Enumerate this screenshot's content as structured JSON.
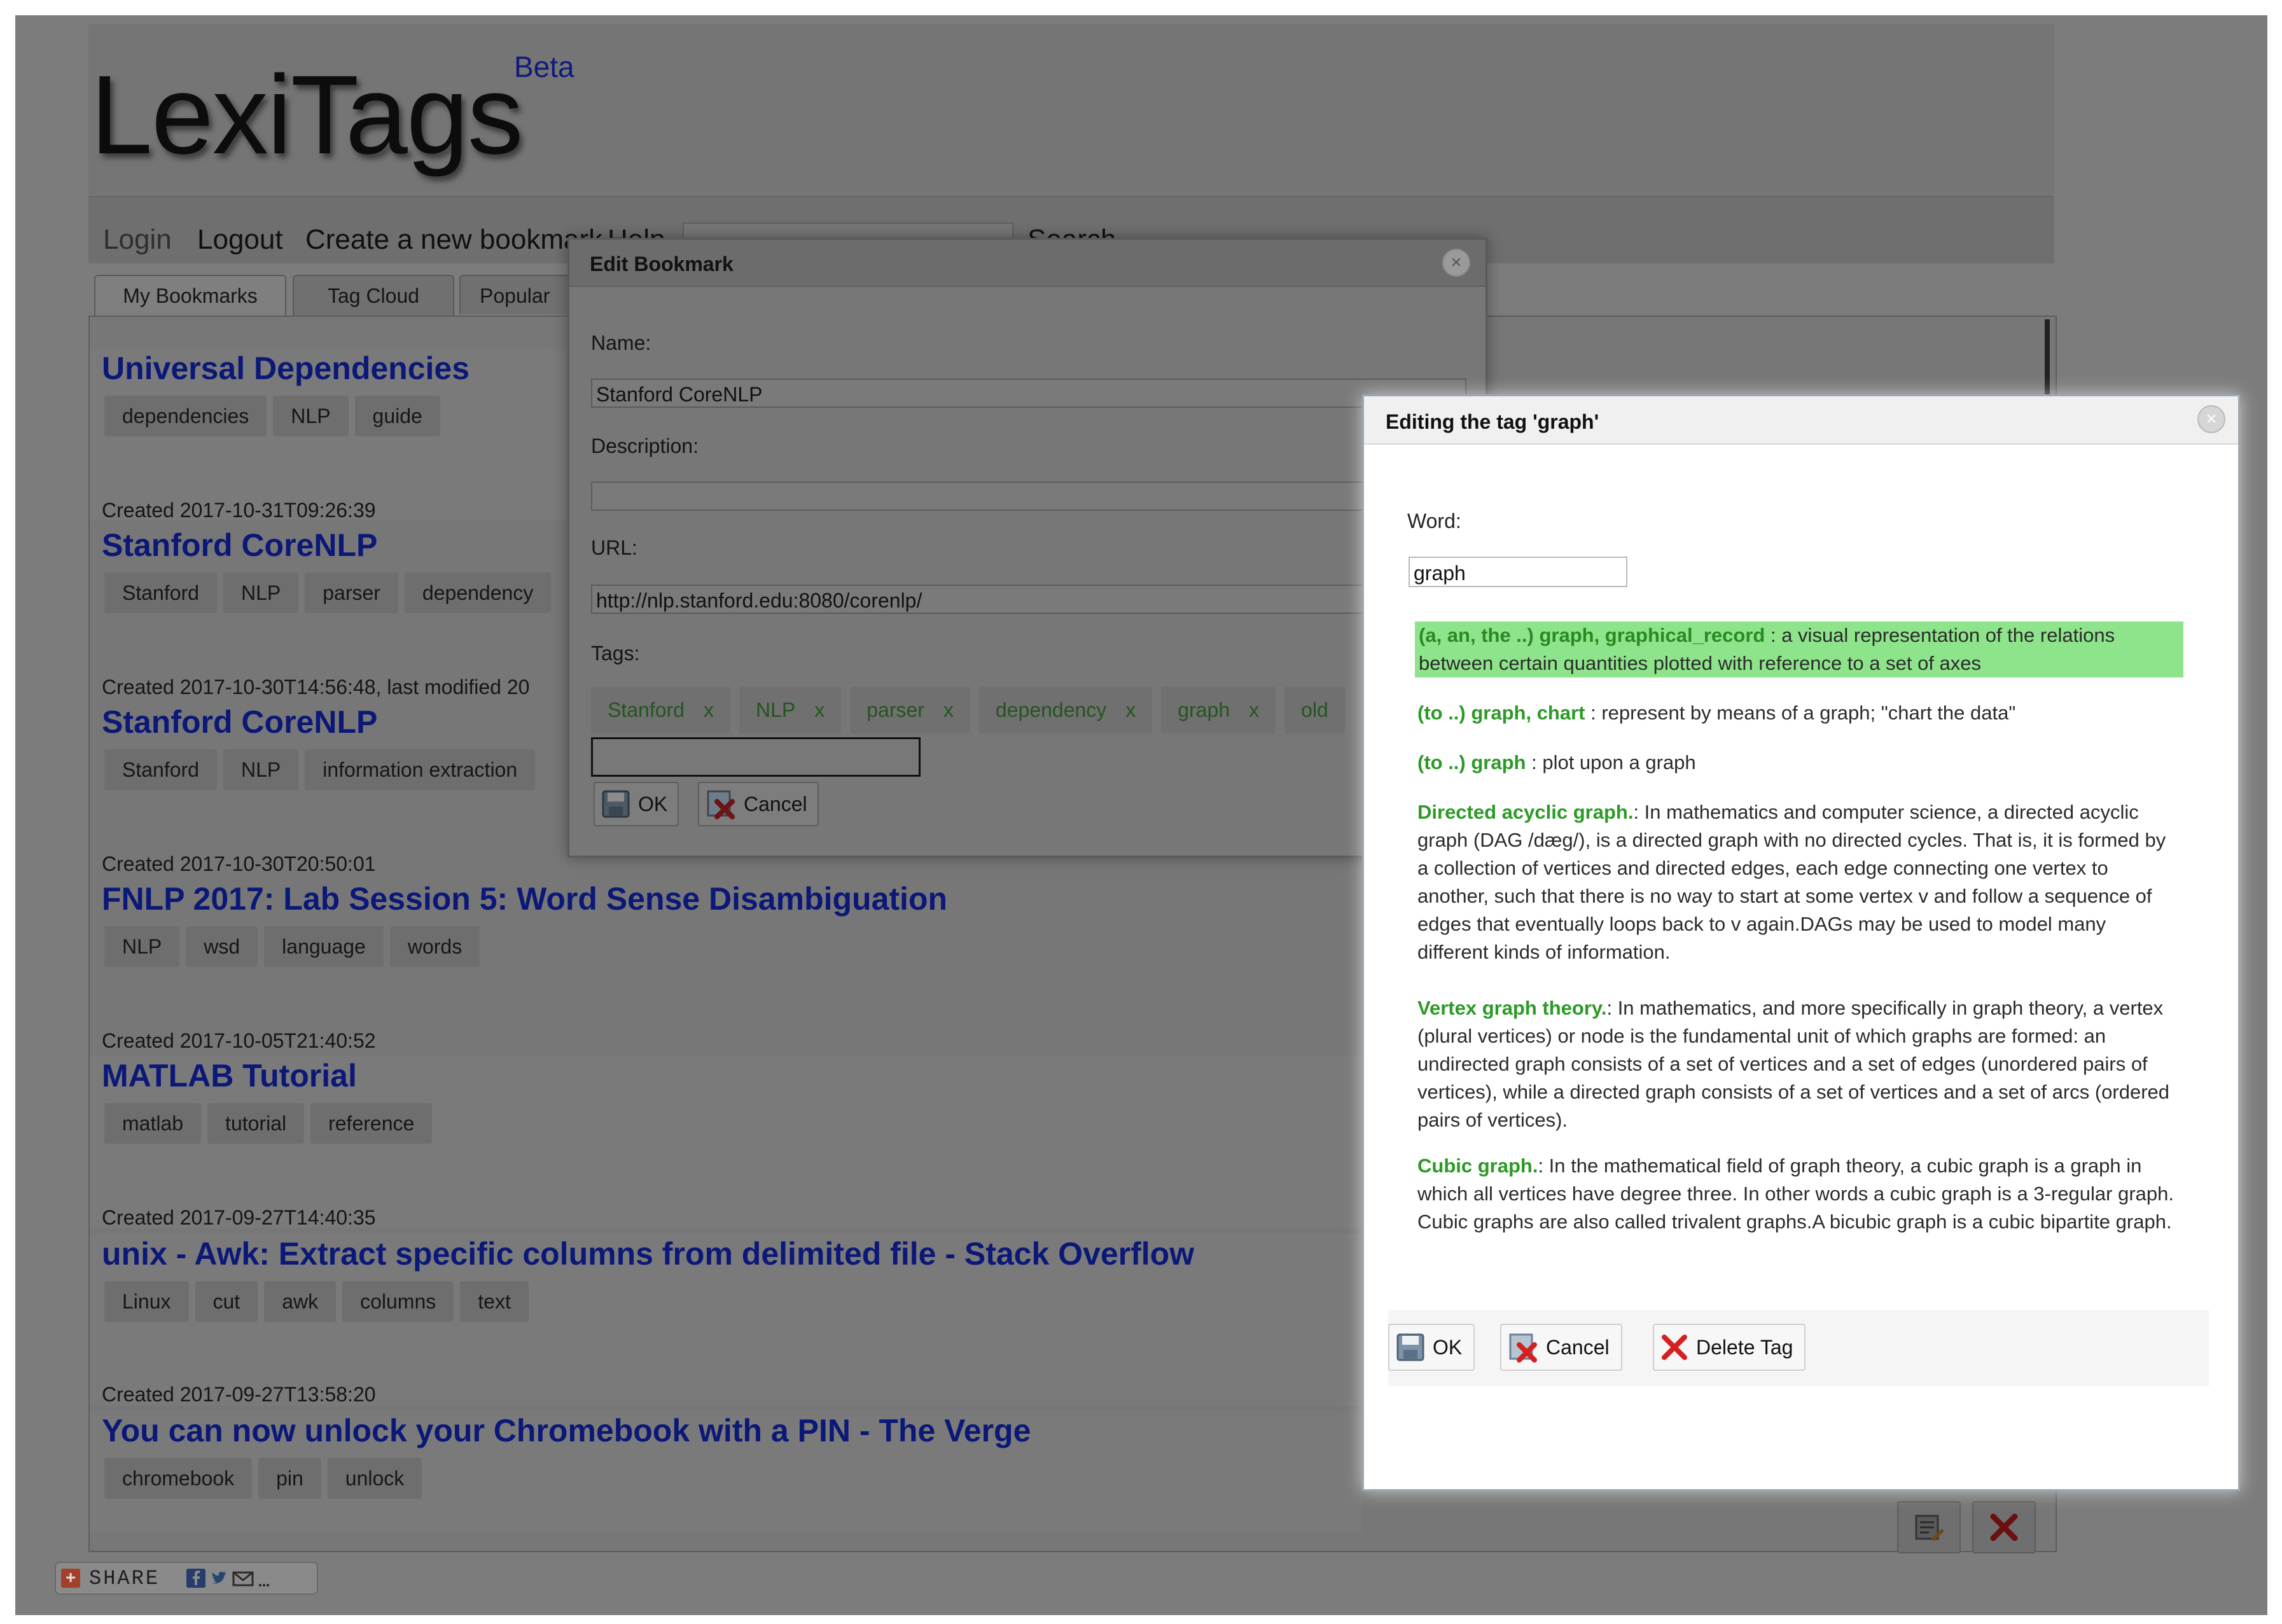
{
  "app": {
    "logo": "LexiTags",
    "beta": "Beta"
  },
  "nav": {
    "login": "Login",
    "logout": "Logout",
    "create": "Create a new bookmark",
    "help": "Help",
    "search_label": "Search"
  },
  "tabs": [
    "My Bookmarks",
    "Tag Cloud",
    "Popular"
  ],
  "bookmarks": [
    {
      "title": "Universal Dependencies",
      "tags": [
        "dependencies",
        "NLP",
        "guide"
      ],
      "created": "Created 2017-10-31T09:26:39"
    },
    {
      "title": "Stanford CoreNLP",
      "tags": [
        "Stanford",
        "NLP",
        "parser",
        "dependency"
      ],
      "created": "Created 2017-10-30T14:56:48, last modified 20"
    },
    {
      "title": "Stanford CoreNLP",
      "tags": [
        "Stanford",
        "NLP",
        "information extraction"
      ],
      "created": "Created 2017-10-30T20:50:01"
    },
    {
      "title": "FNLP 2017: Lab Session 5: Word Sense Disambiguation",
      "tags": [
        "NLP",
        "wsd",
        "language",
        "words"
      ],
      "created": "Created 2017-10-05T21:40:52"
    },
    {
      "title": "MATLAB Tutorial",
      "tags": [
        "matlab",
        "tutorial",
        "reference"
      ],
      "created": "Created 2017-09-27T14:40:35"
    },
    {
      "title": "unix - Awk: Extract specific columns from delimited file - Stack Overflow",
      "tags": [
        "Linux",
        "cut",
        "awk",
        "columns",
        "text"
      ],
      "created": "Created 2017-09-27T13:58:20"
    },
    {
      "title": "You can now unlock your Chromebook with a PIN - The Verge",
      "tags": [
        "chromebook",
        "pin",
        "unlock"
      ],
      "created": ""
    }
  ],
  "share": {
    "label": "SHARE"
  },
  "edit_dialog": {
    "title": "Edit Bookmark",
    "name_label": "Name:",
    "name_value": "Stanford CoreNLP",
    "description_label": "Description:",
    "description_value": "",
    "url_label": "URL:",
    "url_value": "http://nlp.stanford.edu:8080/corenlp/",
    "tags_label": "Tags:",
    "tags": [
      "Stanford",
      "NLP",
      "parser",
      "dependency",
      "graph",
      "old"
    ],
    "tag_remove": "x",
    "ok": "OK",
    "cancel": "Cancel"
  },
  "tag_dialog": {
    "title": "Editing the tag 'graph'",
    "word_label": "Word:",
    "word_value": "graph",
    "senses": [
      {
        "term": "(a, an, the ..) graph, graphical_record",
        "text": " : a visual representation of the relations between certain quantities plotted with reference to a set of axes",
        "selected": true
      },
      {
        "term": "(to ..) graph, chart",
        "text": " : represent by means of a graph; \"chart the data\"",
        "selected": false
      },
      {
        "term": "(to ..) graph",
        "text": " : plot upon a graph",
        "selected": false
      },
      {
        "term": "Directed acyclic graph.",
        "text": ": In mathematics and computer science, a directed acyclic graph (DAG /dæg/), is a directed graph with no directed cycles. That is, it is formed by a collection of vertices and directed edges, each edge connecting one vertex to another, such that there is no way to start at some vertex v and follow a sequence of edges that eventually loops back to v again.DAGs may be used to model many different kinds of information.",
        "selected": false
      },
      {
        "term": "Vertex graph theory.",
        "text": ": In mathematics, and more specifically in graph theory, a vertex (plural vertices) or node is the fundamental unit of which graphs are formed: an undirected graph consists of a set of vertices and a set of edges (unordered pairs of vertices), while a directed graph consists of a set of vertices and a set of arcs (ordered pairs of vertices).",
        "selected": false
      },
      {
        "term": "Cubic graph.",
        "text": ": In the mathematical field of graph theory, a cubic graph is a graph in which all vertices have degree three. In other words a cubic graph is a 3-regular graph. Cubic graphs are also called trivalent graphs.A bicubic graph is a cubic bipartite graph.",
        "selected": false
      }
    ],
    "ok": "OK",
    "cancel": "Cancel",
    "delete": "Delete Tag"
  },
  "colors": {
    "overlay": "#7c7c7c",
    "title_blue": "#0b1877",
    "sense_term_green": "#2c9a26",
    "selected_sense_bg": "#8ee48a",
    "delete_red": "#d42020"
  }
}
